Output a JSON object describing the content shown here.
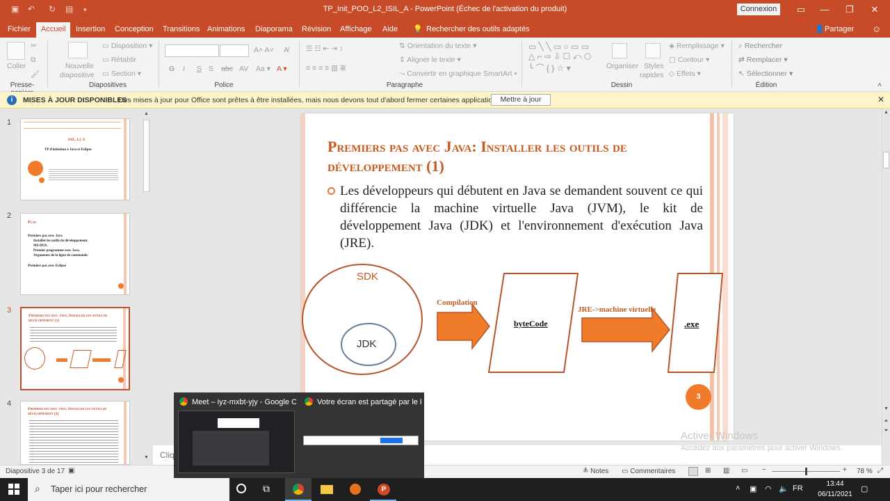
{
  "window": {
    "title": "TP_Init_POO_L2_ISIL_A  -  PowerPoint (Échec de l'activation du produit)",
    "connexion_label": "Connexion"
  },
  "menu": {
    "tabs": [
      "Fichier",
      "Accueil",
      "Insertion",
      "Conception",
      "Transitions",
      "Animations",
      "Diaporama",
      "Révision",
      "Affichage",
      "Aide"
    ],
    "active_tab": "Accueil",
    "search_label": "Rechercher des outils adaptés",
    "share_label": "Partager"
  },
  "ribbon": {
    "paste": "Coller",
    "new_slide_1": "Nouvelle",
    "new_slide_2": "diapositive",
    "layout": "Disposition",
    "reset": "Rétablir",
    "section": "Section",
    "text_direction": "Orientation du texte",
    "align_text": "Aligner le texte",
    "smartart": "Convertir en graphique SmartArt",
    "organize": "Organiser",
    "styles_1": "Styles",
    "styles_2": "rapides",
    "fill": "Remplissage",
    "outline": "Contour",
    "effects": "Effets",
    "find": "Rechercher",
    "replace": "Remplacer",
    "select": "Sélectionner",
    "groups": {
      "clipboard": "Presse-papiers",
      "slides": "Diapositives",
      "font": "Police",
      "paragraph": "Paragraphe",
      "drawing": "Dessin",
      "editing": "Édition"
    }
  },
  "update_bar": {
    "title": "MISES À JOUR DISPONIBLES",
    "message": "Des mises à jour pour Office sont prêtes à être installées, mais nous devons tout d'abord fermer certaines applications.",
    "button": "Mettre à jour"
  },
  "thumbnails": [
    {
      "num": "1",
      "line1": "ISIL, L2, A",
      "line2": "TP d'initiation à Java et Eclipse"
    },
    {
      "num": "2",
      "title": "Plan",
      "items": [
        "Premiers pas avec Java",
        "Installer les outils de développement.",
        "MS-DOS.",
        "Premier programme avec Java.",
        "Arguments de la ligne de commande.",
        "Premiers pas avec Eclipse"
      ]
    },
    {
      "num": "3",
      "title": "Premiers pas avec Java: Installer les outils de développement (1)"
    },
    {
      "num": "4",
      "title": "Premiers pas avec Java: Installer les outils de développement (2)"
    }
  ],
  "slide": {
    "title": "Premiers pas avec Java: Installer les outils de développement (1)",
    "body": "Les développeurs qui débutent en Java se demandent souvent ce qui différencie la machine virtuelle Java (JVM), le kit de développement Java (JDK) et l'environnement d'exécution Java (JRE).",
    "diagram": {
      "sdk": "SDK",
      "jdk": "JDK",
      "compilation": "Compilation",
      "bytecode": "byteCode",
      "jre": "JRE->machine virtuelle",
      "exe": ".exe"
    },
    "page_number": "3"
  },
  "notes_placeholder": "Cliq",
  "status": {
    "slide_info": "Diapositive 3 de 17",
    "notes": "Notes",
    "comments": "Commentaires",
    "zoom": "78 %"
  },
  "taskbar": {
    "search_placeholder": "Taper ici pour rechercher",
    "time": "13:44",
    "date": "06/11/2021"
  },
  "popup": {
    "tab1": "Meet – iyz-mxbt-yjy - Google C...",
    "tab2": "Votre écran est partagé par le b..."
  },
  "watermark": {
    "line1": "Activer Windows",
    "line2": "Accédez aux paramètres pour activer Windows."
  },
  "colors": {
    "accent": "#c84b29",
    "slide_title": "#c65a1e",
    "arrow": "#f07b2a"
  }
}
